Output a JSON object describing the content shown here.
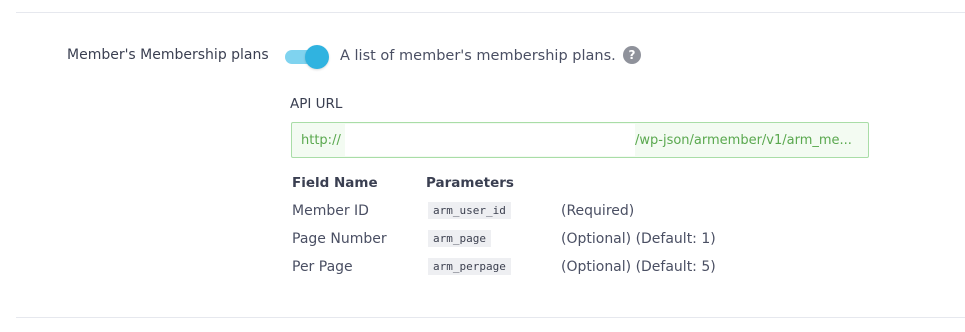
{
  "setting": {
    "label": "Member's Membership plans",
    "toggle_state": "on",
    "description": "A list of member's membership plans.",
    "help_icon_glyph": "?"
  },
  "api": {
    "label": "API URL",
    "url_prefix": "http://",
    "url_suffix": "/wp-json/armember/v1/arm_me..."
  },
  "table": {
    "headers": {
      "field": "Field Name",
      "param": "Parameters"
    },
    "rows": [
      {
        "field": "Member ID",
        "param": "arm_user_id",
        "note": "(Required)"
      },
      {
        "field": "Page Number",
        "param": "arm_page",
        "note": "(Optional) (Default: 1)"
      },
      {
        "field": "Per Page",
        "param": "arm_perpage",
        "note": "(Optional) (Default: 5)"
      }
    ]
  },
  "colors": {
    "toggle_track": "#7fd3ef",
    "toggle_knob": "#30b3e0",
    "url_text": "#5aa84f",
    "url_border": "#a9dda7",
    "help_icon_bg": "#8f929b"
  }
}
